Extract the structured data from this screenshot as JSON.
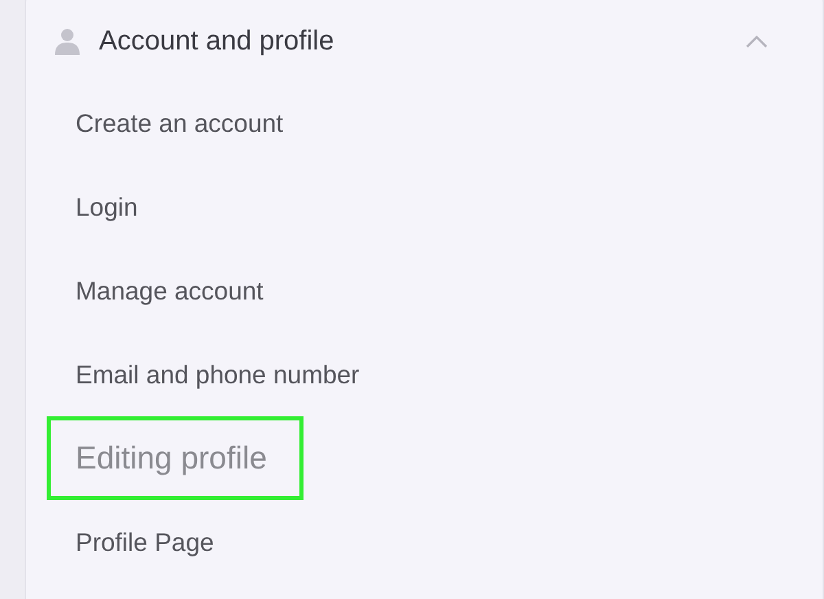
{
  "section": {
    "title": "Account and profile",
    "expanded": true,
    "items": [
      {
        "label": "Create an account",
        "highlighted": false
      },
      {
        "label": "Login",
        "highlighted": false
      },
      {
        "label": "Manage account",
        "highlighted": false
      },
      {
        "label": "Email and phone number",
        "highlighted": false
      },
      {
        "label": "Editing profile",
        "highlighted": true
      },
      {
        "label": "Profile Page",
        "highlighted": false
      }
    ]
  }
}
